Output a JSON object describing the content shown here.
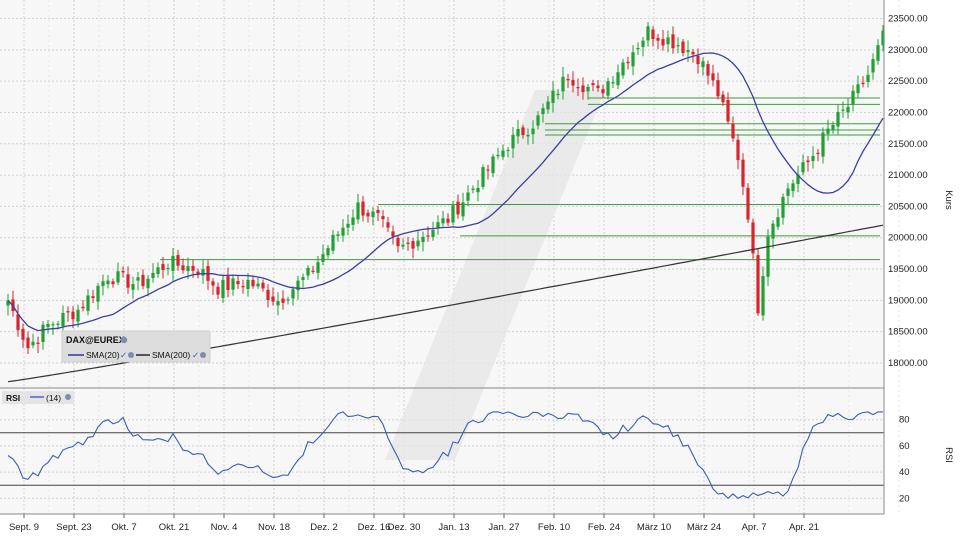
{
  "chart_data": [
    {
      "type": "candlestick",
      "panel": "price",
      "ylabel": "Kurs",
      "ylim": [
        17600,
        23700
      ],
      "yticks": [
        18000,
        18500,
        19000,
        19500,
        20000,
        20500,
        21000,
        21500,
        22000,
        22500,
        23000,
        23500
      ],
      "ytick_labels": [
        "18000.00",
        "18500.00",
        "19000.00",
        "19500.00",
        "20000.00",
        "20500.00",
        "21000.00",
        "21500.00",
        "22000.00",
        "22500.00",
        "23000.00",
        "23500.00"
      ],
      "x_labels": [
        "Sept. 9",
        "Sept. 23",
        "Okt. 7",
        "Okt. 21",
        "Nov. 4",
        "Nov. 18",
        "Dez. 2",
        "Dez. 16",
        "Dez. 30",
        "Jan. 13",
        "Jan. 27",
        "Feb. 10",
        "Feb. 24",
        "März 10",
        "März 24",
        "Apr. 7",
        "Apr. 21"
      ],
      "x_label_index": [
        0,
        10,
        20,
        30,
        40,
        50,
        60,
        70,
        76,
        86,
        96,
        106,
        116,
        126,
        136,
        146,
        156
      ],
      "legend": {
        "title": "DAX@EUREX",
        "items": [
          "SMA(20)",
          "SMA(200)"
        ]
      },
      "series": [
        {
          "name": "SMA(20)",
          "color": "#3a3fa0"
        },
        {
          "name": "SMA(200)",
          "color": "#333333"
        }
      ],
      "support_lines": [
        22230,
        22130,
        21820,
        21720,
        21640,
        20530,
        20030,
        19650
      ],
      "grid": true,
      "colors": {
        "up": "#22a033",
        "down": "#d8242c",
        "support": "#3f9a3f"
      }
    },
    {
      "type": "line",
      "panel": "rsi",
      "ylabel": "RSI",
      "legend": {
        "title": "RSI",
        "items": [
          "(14)"
        ]
      },
      "ylim": [
        8,
        92
      ],
      "yticks": [
        20,
        40,
        60,
        80
      ],
      "ytick_labels": [
        "20",
        "40",
        "60",
        "80"
      ],
      "reference_lines": [
        30,
        70
      ],
      "series": [
        {
          "name": "(14)",
          "color": "#3a5fb0"
        }
      ]
    }
  ]
}
